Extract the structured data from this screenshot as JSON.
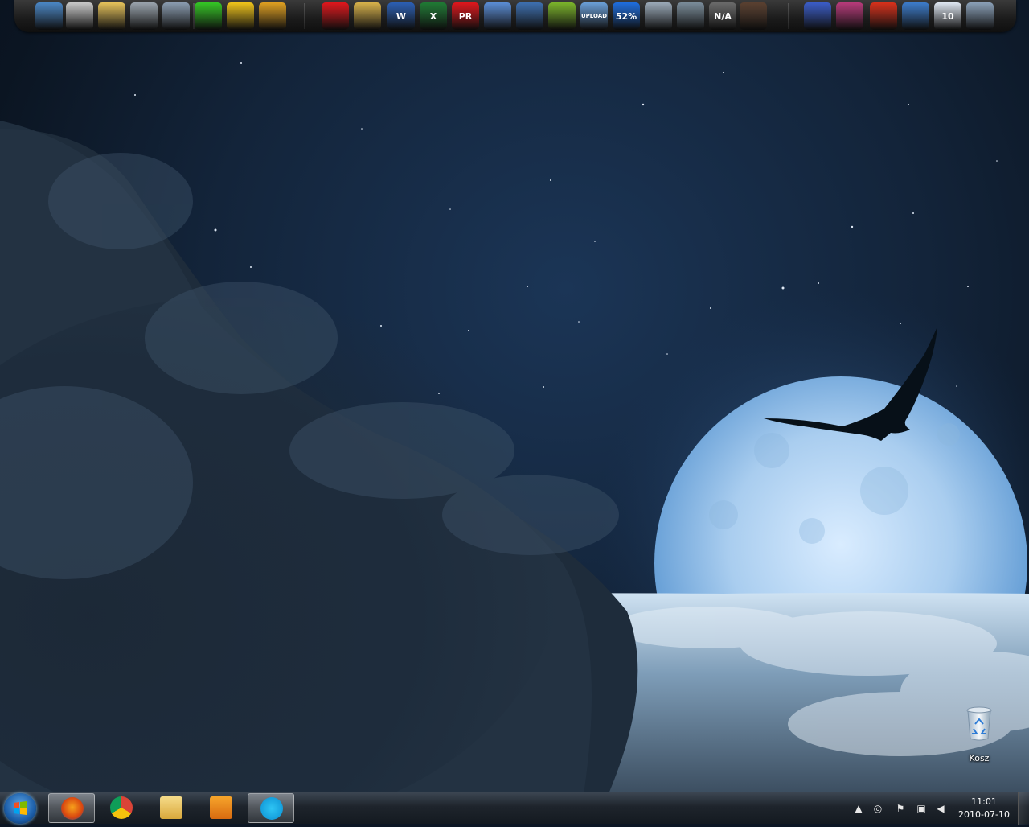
{
  "dock": {
    "icons": [
      {
        "name": "computer-icon",
        "color": "#4a86c5"
      },
      {
        "name": "documents-icon",
        "color": "#c9c9c9"
      },
      {
        "name": "downloads-folder-icon",
        "color": "#e7c35a"
      },
      {
        "name": "pictures-folder-icon",
        "color": "#9aa4ad"
      },
      {
        "name": "music-folder-icon",
        "color": "#8a9cb0"
      },
      {
        "name": "meter-icon",
        "color": "#34c724"
      },
      {
        "name": "tools-icon",
        "color": "#f0c419"
      },
      {
        "name": "lightning-app-icon",
        "color": "#e0a020"
      },
      {
        "name": "paint-splash-icon",
        "color": "#e0161b"
      },
      {
        "name": "archive-folder-icon",
        "color": "#d8b24a"
      },
      {
        "name": "word-icon",
        "color": "#2b5fb4",
        "text": "W"
      },
      {
        "name": "excel-icon",
        "color": "#1f7a34",
        "text": "X"
      },
      {
        "name": "foxit-reader-icon",
        "color": "#e0161b",
        "text": "PR"
      },
      {
        "name": "notepad-icon",
        "color": "#5a8dd6"
      },
      {
        "name": "internet-globe-icon",
        "color": "#3d6fb0"
      },
      {
        "name": "torrent-icon",
        "color": "#7bb52a"
      },
      {
        "name": "upload-icon",
        "color": "#6a9fd8",
        "text": "UPLOAD"
      },
      {
        "name": "cpu-meter-icon",
        "color": "#1e6ee0",
        "text": "52%"
      },
      {
        "name": "mail-icon",
        "color": "#9aa9b8"
      },
      {
        "name": "media-player-icon",
        "color": "#7a8c9a"
      },
      {
        "name": "weather-gadget-icon",
        "color": "#6a6a6a",
        "text": "N/A"
      },
      {
        "name": "user-photo-icon",
        "color": "#5a4030"
      },
      {
        "name": "save-disk-icon",
        "color": "#3a5cc8"
      },
      {
        "name": "winrar-icon",
        "color": "#b83a7a"
      },
      {
        "name": "ccleaner-icon",
        "color": "#d8301a"
      },
      {
        "name": "settings-icon",
        "color": "#3c7ccc"
      },
      {
        "name": "calendar-icon",
        "color": "#dfe7f2",
        "text": "10"
      },
      {
        "name": "recycle-dock-icon",
        "color": "#8aa0b8"
      }
    ]
  },
  "desktop": {
    "recycle_bin_label": "Kosz"
  },
  "taskbar": {
    "pinned": [
      {
        "name": "firefox-button",
        "icon": "firefox-icon",
        "active": true
      },
      {
        "name": "chrome-button",
        "icon": "chrome-icon",
        "active": false
      },
      {
        "name": "explorer-button",
        "icon": "folder-icon",
        "active": false
      },
      {
        "name": "media-player-button",
        "icon": "media-player-icon",
        "active": false
      },
      {
        "name": "skype-button",
        "icon": "skype-icon",
        "active": true
      }
    ],
    "clock_time": "11:01",
    "clock_date": "2010-07-10"
  }
}
